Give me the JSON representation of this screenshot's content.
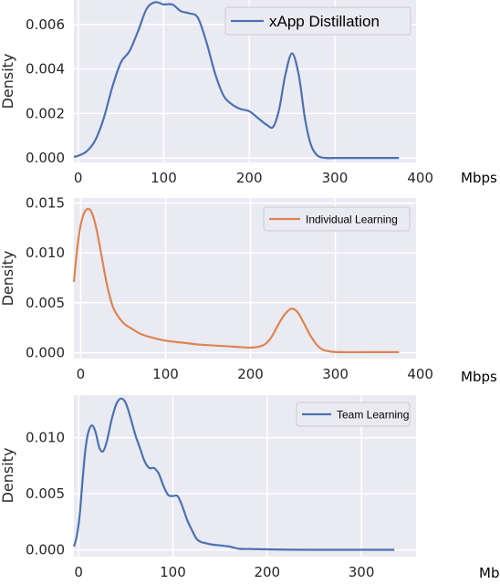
{
  "chart_data": [
    {
      "type": "line",
      "title": "",
      "xlabel": "Mbps",
      "ylabel": "Density",
      "xlim": [
        -5,
        395
      ],
      "ylim": [
        -0.0002,
        0.0071
      ],
      "xticks": [
        0,
        100,
        200,
        300,
        400
      ],
      "xtick_labels": [
        "0",
        "100",
        "200",
        "300",
        "400"
      ],
      "yticks": [
        0.0,
        0.002,
        0.004,
        0.006
      ],
      "ytick_labels": [
        "0.000",
        "0.002",
        "0.004",
        "0.006"
      ],
      "grid": true,
      "legend": {
        "position": "top-right",
        "size": "large"
      },
      "series": [
        {
          "name": "xApp Distillation",
          "color": "#4c72b0",
          "x": [
            -5,
            0,
            10,
            20,
            30,
            40,
            50,
            60,
            70,
            80,
            90,
            100,
            110,
            120,
            130,
            140,
            150,
            160,
            170,
            180,
            190,
            200,
            210,
            220,
            228,
            235,
            242,
            250,
            258,
            265,
            272,
            280,
            290,
            300,
            320,
            340,
            360,
            375
          ],
          "y": [
            5e-05,
            0.0001,
            0.0003,
            0.0008,
            0.0018,
            0.0032,
            0.0043,
            0.0048,
            0.0057,
            0.0067,
            0.007,
            0.0069,
            0.0069,
            0.0066,
            0.0065,
            0.0063,
            0.0052,
            0.0038,
            0.0028,
            0.0024,
            0.0022,
            0.0021,
            0.0018,
            0.0015,
            0.0014,
            0.0022,
            0.0037,
            0.0047,
            0.0037,
            0.0018,
            0.0006,
            0.0001,
            0.0,
            0.0,
            0.0,
            0.0,
            0.0,
            0.0
          ]
        }
      ]
    },
    {
      "type": "line",
      "title": "",
      "xlabel": "Mbps",
      "ylabel": "Density",
      "xlim": [
        -8,
        395
      ],
      "ylim": [
        -0.0006,
        0.0155
      ],
      "xticks": [
        0,
        100,
        200,
        300,
        400
      ],
      "xtick_labels": [
        "0",
        "100",
        "200",
        "300",
        "400"
      ],
      "yticks": [
        0.0,
        0.005,
        0.01,
        0.015
      ],
      "ytick_labels": [
        "0.000",
        "0.005",
        "0.010",
        "0.015"
      ],
      "grid": true,
      "legend": {
        "position": "top-right",
        "size": "small"
      },
      "series": [
        {
          "name": "Individual Learning",
          "color": "#dd8452",
          "x": [
            -8,
            -4,
            0,
            4,
            8,
            12,
            16,
            20,
            25,
            30,
            35,
            40,
            50,
            60,
            70,
            80,
            100,
            120,
            140,
            160,
            180,
            200,
            210,
            218,
            225,
            232,
            240,
            248,
            255,
            262,
            270,
            278,
            285,
            295,
            310,
            340,
            375
          ],
          "y": [
            0.0071,
            0.0105,
            0.0128,
            0.014,
            0.0144,
            0.0142,
            0.0133,
            0.0118,
            0.0095,
            0.0072,
            0.0054,
            0.0042,
            0.003,
            0.0024,
            0.0019,
            0.0016,
            0.0012,
            0.001,
            0.0008,
            0.0007,
            0.0006,
            0.0005,
            0.0006,
            0.0009,
            0.0016,
            0.0027,
            0.0038,
            0.0044,
            0.0041,
            0.0031,
            0.0018,
            0.0008,
            0.0003,
            0.0001,
            5e-05,
            5e-05,
            5e-05
          ]
        }
      ]
    },
    {
      "type": "line",
      "title": "",
      "xlabel": "Mbps",
      "ylabel": "Density",
      "xlim": [
        -5,
        358
      ],
      "ylim": [
        -0.0006,
        0.0138
      ],
      "xticks": [
        0,
        100,
        200,
        300
      ],
      "xtick_labels": [
        "0",
        "100",
        "200",
        "300"
      ],
      "yticks": [
        0.0,
        0.005,
        0.01
      ],
      "ytick_labels": [
        "0.000",
        "0.005",
        "0.010"
      ],
      "grid": true,
      "legend": {
        "position": "top-right",
        "size": "small"
      },
      "series": [
        {
          "name": "Team Learning",
          "color": "#4c72b0",
          "x": [
            -5,
            -2,
            1,
            4,
            7,
            10,
            14,
            18,
            22,
            26,
            30,
            35,
            40,
            45,
            50,
            55,
            60,
            65,
            70,
            75,
            80,
            85,
            90,
            95,
            100,
            105,
            110,
            115,
            120,
            125,
            130,
            135,
            140,
            150,
            160,
            170,
            180,
            200,
            220,
            260,
            300,
            335
          ],
          "y": [
            0.0003,
            0.0012,
            0.003,
            0.006,
            0.0088,
            0.0104,
            0.0111,
            0.0105,
            0.0091,
            0.0088,
            0.0097,
            0.0116,
            0.013,
            0.0135,
            0.0131,
            0.0118,
            0.0103,
            0.0091,
            0.0079,
            0.0073,
            0.0073,
            0.0068,
            0.0057,
            0.0049,
            0.0048,
            0.0048,
            0.0039,
            0.0027,
            0.0018,
            0.001,
            0.0007,
            0.0006,
            0.0005,
            0.0004,
            0.0003,
            0.0001,
            8e-05,
            5e-05,
            2e-05,
            1e-05,
            1e-05,
            1e-05
          ]
        }
      ]
    }
  ]
}
